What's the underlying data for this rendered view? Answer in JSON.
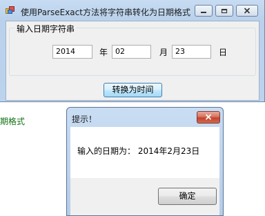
{
  "main_window": {
    "title": "使用ParseExact方法将字符串转化为日期格式",
    "group_title": "输入日期字符串",
    "year_value": "2014",
    "year_label": "年",
    "month_value": "02",
    "month_label": "月",
    "day_value": "23",
    "day_label": "日",
    "convert_button": "转换为时间"
  },
  "background_text": "期格式",
  "message_box": {
    "title": "提示！",
    "message": "输入的日期为： 2014年2月23日",
    "ok_button": "确定"
  },
  "colors": {
    "title_bar": "#c7dcf2",
    "client_bg": "#f0f0f0",
    "background_text": "#117011",
    "close_button": "#c4432b"
  }
}
